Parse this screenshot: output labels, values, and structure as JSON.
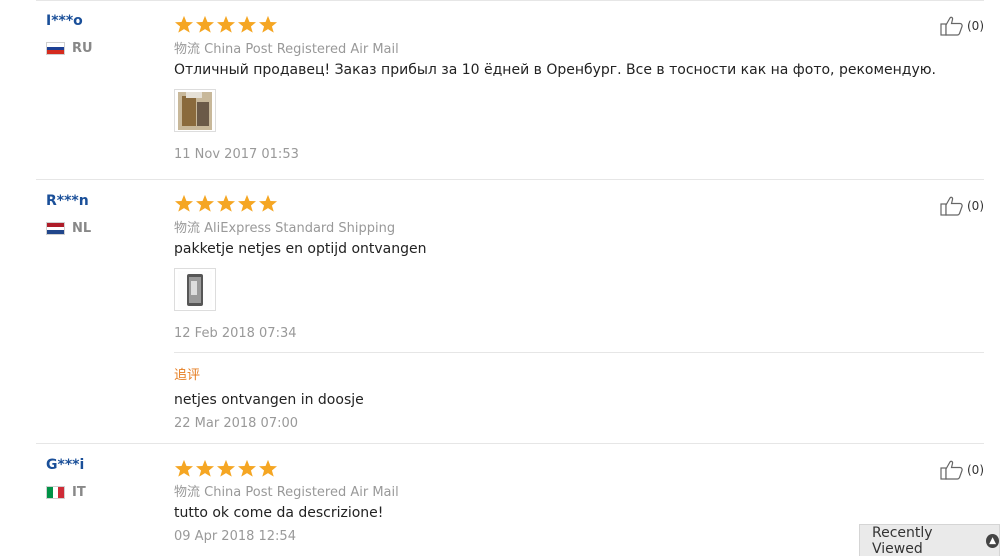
{
  "reviews": [
    {
      "user": "I***o",
      "country": "RU",
      "rating": 5,
      "shipping": "物流 China Post Registered Air Mail",
      "text": "Отличный продавец! Заказ прибыл за 10 ёдней в Оренбург. Все в тосности как на фото, рекомендую.",
      "date": "11 Nov 2017 01:53",
      "helpful": "(0)",
      "flag_colors": [
        "#ffffff",
        "#1c3f94",
        "#d52b1e"
      ]
    },
    {
      "user": "R***n",
      "country": "NL",
      "rating": 5,
      "shipping": "物流 AliExpress Standard Shipping",
      "text": "pakketje netjes en optijd ontvangen",
      "date": "12 Feb 2018 07:34",
      "helpful": "(0)",
      "flag_colors": [
        "#ae1c28",
        "#ffffff",
        "#21468b"
      ],
      "additional": {
        "label": "追评",
        "text": "netjes ontvangen in doosje",
        "date": "22 Mar 2018 07:00"
      }
    },
    {
      "user": "G***i",
      "country": "IT",
      "rating": 5,
      "shipping": "物流 China Post Registered Air Mail",
      "text": "tutto ok come da descrizione!",
      "date": "09 Apr 2018 12:54",
      "helpful": "(0)",
      "flag_colors": [
        "#009246",
        "#ffffff",
        "#ce2b37"
      ]
    }
  ],
  "recently_viewed": "Recently Viewed",
  "colors": {
    "star": "#f5a623",
    "username": "#1a4f99",
    "additional_label": "#e67e22"
  },
  "icons": {
    "rating": "star-icon",
    "helpful": "thumbs-up-icon"
  }
}
